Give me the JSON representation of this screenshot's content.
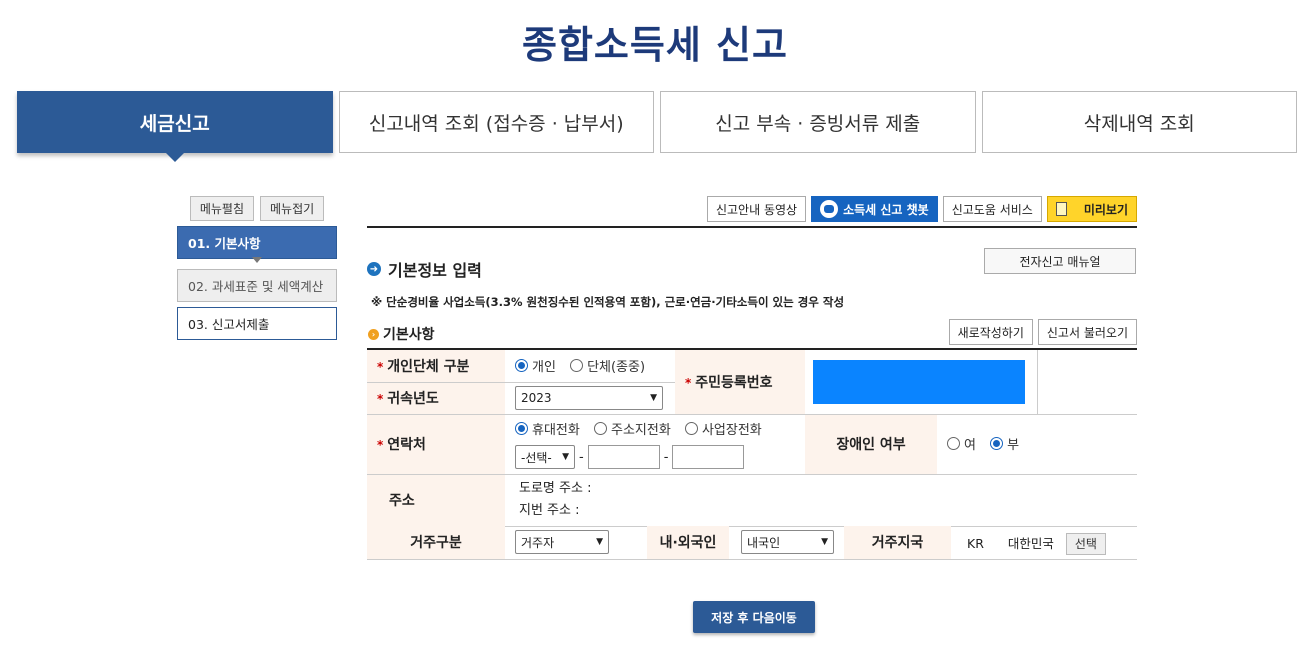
{
  "page": {
    "title": "종합소득세 신고"
  },
  "tabs": [
    {
      "label": "세금신고",
      "active": true
    },
    {
      "label": "신고내역 조회 (접수증 · 납부서)"
    },
    {
      "label": "신고 부속 · 증빙서류 제출"
    },
    {
      "label": "삭제내역 조회"
    }
  ],
  "leftnav": {
    "expand_label": "메뉴펼침",
    "collapse_label": "메뉴접기",
    "steps": [
      "01. 기본사항",
      "02. 과세표준 및 세액계산",
      "03. 신고서제출"
    ]
  },
  "toolbar": {
    "video": "신고안내 동영상",
    "chatbot": "소득세 신고 챗봇",
    "help": "신고도움 서비스",
    "preview": "미리보기"
  },
  "section": {
    "title": "기본정보 입력",
    "manual": "전자신고 매뉴얼",
    "note": "※ 단순경비율 사업소득(3.3% 원천징수된 인적용역 포함), 근로·연금·기타소득이 있는 경우 작성",
    "subtitle": "기본사항",
    "new_btn": "새로작성하기",
    "load_btn": "신고서 불러오기"
  },
  "form": {
    "type_label": "개인단체 구분",
    "type_options": [
      "개인",
      "단체(종중)"
    ],
    "year_label": "귀속년도",
    "year_value": "2023",
    "rrn_label": "주민등록번호",
    "contact_label": "연락처",
    "contact_options": [
      "휴대전화",
      "주소지전화",
      "사업장전화"
    ],
    "phone_select": "-선택-",
    "dash": "-",
    "disabled_label": "장애인 여부",
    "disabled_options": [
      "여",
      "부"
    ],
    "address_label": "주소",
    "road_address": "도로명 주소 :",
    "lot_address": "지번 주소 :",
    "residence_label": "거주구분",
    "residence_value": "거주자",
    "nationality_label": "내·외국인",
    "nationality_value": "내국인",
    "country_label": "거주지국",
    "country_code": "KR",
    "country_name": "대한민국",
    "select_btn": "선택"
  },
  "footer": {
    "next": "저장 후 다음이동"
  },
  "colors": {
    "primary": "#2c5a96",
    "title": "#1d3a7a",
    "accent_blue": "#1664c0",
    "redacted": "#0a84ff",
    "label_bg": "#fdf3ec",
    "preview_yellow": "#ffd42a"
  }
}
